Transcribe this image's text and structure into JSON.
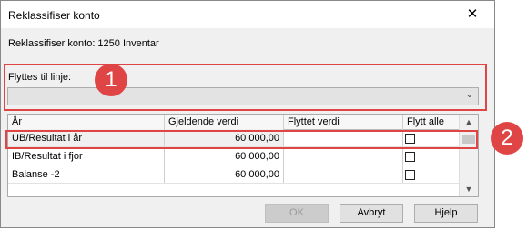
{
  "window": {
    "title": "Reklassifiser konto",
    "close_glyph": "✕"
  },
  "subtitle": "Reklassifiser konto: 1250 Inventar",
  "move_to": {
    "label": "Flyttes til linje:",
    "value": ""
  },
  "grid": {
    "columns": [
      "År",
      "Gjeldende verdi",
      "Flyttet verdi",
      "Flytt alle"
    ],
    "rows": [
      {
        "year": "UB/Resultat i år",
        "current": "60 000,00",
        "moved": "",
        "move_all": false
      },
      {
        "year": "IB/Resultat i fjor",
        "current": "60 000,00",
        "moved": "",
        "move_all": false
      },
      {
        "year": "Balanse -2",
        "current": "60 000,00",
        "moved": "",
        "move_all": false
      }
    ]
  },
  "buttons": {
    "ok": "OK",
    "cancel": "Avbryt",
    "help": "Hjelp"
  },
  "annotations": {
    "badge1": "1",
    "badge2": "2",
    "color": "#e04545"
  },
  "icons": {
    "close": "close-icon",
    "dropdown": "chevron-down-icon",
    "scroll_up": "chevron-up-icon",
    "scroll_down": "chevron-down-icon"
  }
}
